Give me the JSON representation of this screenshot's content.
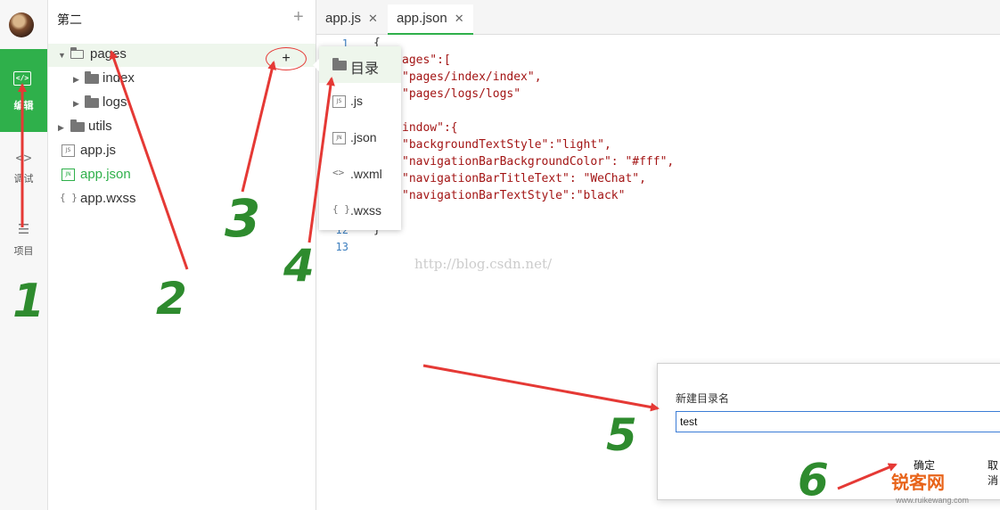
{
  "sidebar": {
    "nav": [
      {
        "label": "编辑",
        "icon": "code-icon",
        "active": true
      },
      {
        "label": "调试",
        "icon": "debug-icon"
      },
      {
        "label": "项目",
        "icon": "project-icon"
      }
    ]
  },
  "tree": {
    "title": "第二",
    "add_icon": "plus-icon",
    "rows": [
      {
        "label": "pages",
        "type": "folder-open"
      },
      {
        "label": "index",
        "type": "folder"
      },
      {
        "label": "logs",
        "type": "folder"
      },
      {
        "label": "utils",
        "type": "folder"
      },
      {
        "label": "app.js",
        "type": "js"
      },
      {
        "label": "app.json",
        "type": "json",
        "active": true
      },
      {
        "label": "app.wxss",
        "type": "wxss"
      }
    ],
    "row_add_button": "+"
  },
  "tabs": [
    {
      "label": "app.js",
      "close": "✕"
    },
    {
      "label": "app.json",
      "close": "✕",
      "active": true
    }
  ],
  "editor": {
    "line_numbers": [
      "1",
      "12",
      "13"
    ],
    "code_lines": [
      "{",
      "ages\":[",
      "\"pages/index/index\",",
      "\"pages/logs/logs\"",
      "indow\":{",
      "\"backgroundTextStyle\":\"light\",",
      "\"navigationBarBackgroundColor\": \"#fff\",",
      "\"navigationBarTitleText\": \"WeChat\",",
      "\"navigationBarTextStyle\":\"black\"",
      "}"
    ],
    "watermark": "http://blog.csdn.net/"
  },
  "context_menu": {
    "items": [
      {
        "label": "目录",
        "icon": "folder-icon"
      },
      {
        "label": ".js",
        "icon": "js-file-icon"
      },
      {
        "label": ".json",
        "icon": "json-file-icon"
      },
      {
        "label": ".wxml",
        "icon": "wxml-file-icon"
      },
      {
        "label": ".wxss",
        "icon": "wxss-file-icon"
      }
    ]
  },
  "dialog": {
    "title": "新建目录名",
    "input_value": "test",
    "ok_label": "确定",
    "cancel_label": "取消"
  },
  "site_logo": {
    "name": "锐客网",
    "url": "www.ruikewang.com"
  },
  "annotations": [
    "1",
    "2",
    "3",
    "4",
    "5",
    "6"
  ],
  "colors": {
    "accent": "#2fb04b",
    "annotation_arrow": "#e53935",
    "annotation_number": "#2e8b2e"
  }
}
